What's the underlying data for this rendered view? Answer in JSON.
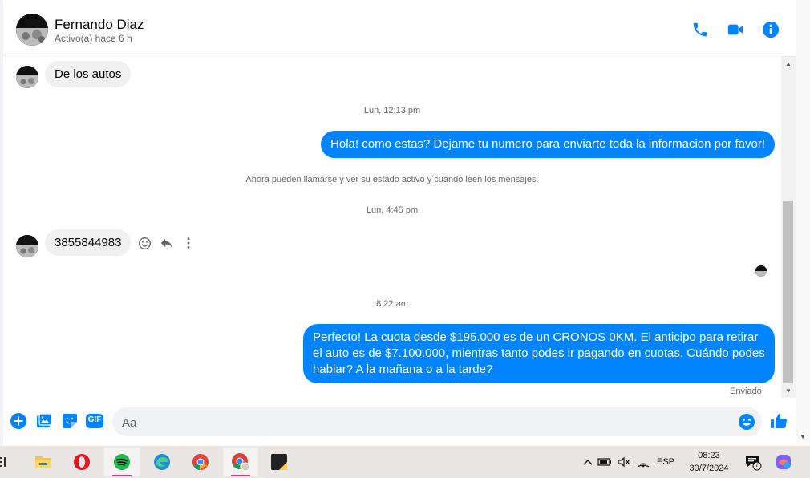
{
  "header": {
    "name": "Fernando Diaz",
    "status": "Activo(a) hace 6 h",
    "icons": [
      "phone-icon",
      "video-camera-icon",
      "info-icon"
    ],
    "accent_color": "#0084ff"
  },
  "messages": {
    "incoming_1": "De los autos",
    "timestamp_1": "Lun, 12:13 pm",
    "outgoing_1": "Hola! como estas? Dejame tu numero para enviarte toda la informacion por favor!",
    "system_notice": "Ahora pueden llamarse y ver su estado activo y cuándo leen los mensajes.",
    "timestamp_2": "Lun, 4:45 pm",
    "incoming_2": "3855844983",
    "timestamp_3": "8:22 am",
    "outgoing_2": "Perfecto! La cuota desde $195.000 es de un CRONOS 0KM. El anticipo para retirar el auto es de $7.100.000, mientras tanto podes ir pagando en cuotas. Cuándo podes hablar? A la mañana o a la tarde?",
    "sent_status": "Enviado"
  },
  "composer": {
    "placeholder": "Aa",
    "gif_label": "GIF",
    "icons": [
      "plus-icon",
      "image-icon",
      "sticker-icon",
      "gif-icon",
      "emoji-icon",
      "thumbs-up-icon"
    ]
  },
  "taskbar": {
    "apps": [
      "file-explorer-icon",
      "opera-icon",
      "spotify-icon",
      "edge-icon",
      "chrome-icon",
      "chrome-profile-icon",
      "sticky-notes-icon"
    ],
    "language": "ESP",
    "time": "08:23",
    "date": "30/7/2024",
    "notification_count": "7"
  }
}
